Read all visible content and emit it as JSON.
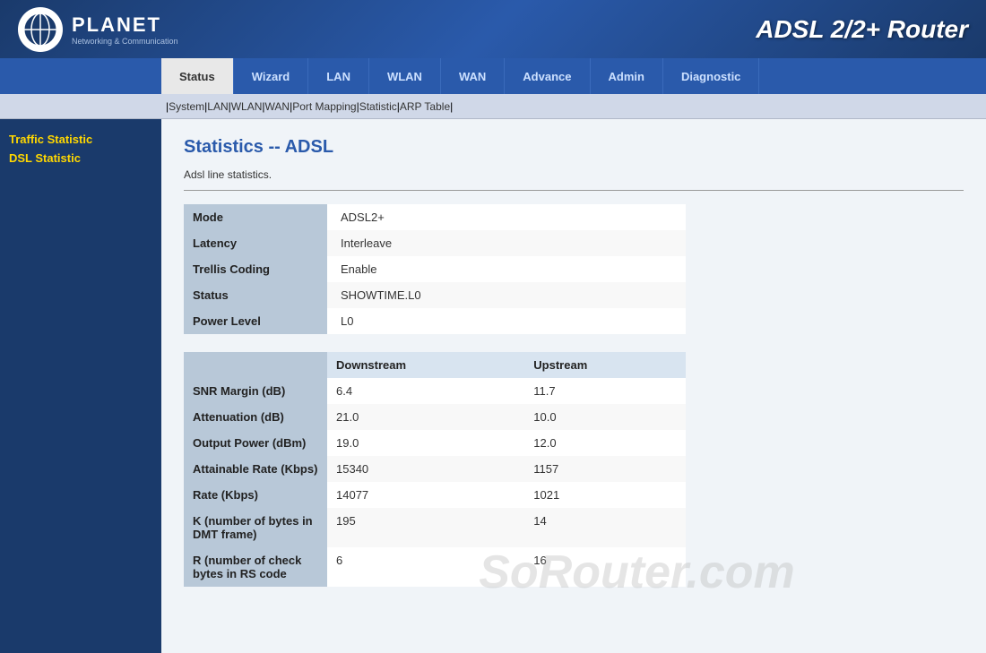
{
  "header": {
    "brand": "PLANET",
    "tagline": "Networking & Communication",
    "router_title": "ADSL 2/2+ Router"
  },
  "navbar": {
    "items": [
      {
        "id": "status",
        "label": "Status",
        "active": true
      },
      {
        "id": "wizard",
        "label": "Wizard",
        "active": false
      },
      {
        "id": "lan",
        "label": "LAN",
        "active": false
      },
      {
        "id": "wlan",
        "label": "WLAN",
        "active": false
      },
      {
        "id": "wan",
        "label": "WAN",
        "active": false
      },
      {
        "id": "advance",
        "label": "Advance",
        "active": false
      },
      {
        "id": "admin",
        "label": "Admin",
        "active": false
      },
      {
        "id": "diagnostic",
        "label": "Diagnostic",
        "active": false
      }
    ]
  },
  "subnav": {
    "links": [
      "System",
      "LAN",
      "WLAN",
      "WAN",
      "Port Mapping",
      "Statistic",
      "ARP Table"
    ]
  },
  "sidebar": {
    "items": [
      {
        "id": "traffic-statistic",
        "label": "Traffic Statistic"
      },
      {
        "id": "dsl-statistic",
        "label": "DSL Statistic"
      }
    ]
  },
  "main": {
    "page_title": "Statistics -- ADSL",
    "description": "Adsl line statistics.",
    "basic_stats": [
      {
        "label": "Mode",
        "value": "ADSL2+"
      },
      {
        "label": "Latency",
        "value": "Interleave"
      },
      {
        "label": "Trellis Coding",
        "value": "Enable"
      },
      {
        "label": "Status",
        "value": "SHOWTIME.L0"
      },
      {
        "label": "Power Level",
        "value": "L0"
      }
    ],
    "metrics": {
      "col_downstream": "Downstream",
      "col_upstream": "Upstream",
      "rows": [
        {
          "label": "SNR Margin (dB)",
          "downstream": "6.4",
          "upstream": "11.7"
        },
        {
          "label": "Attenuation (dB)",
          "downstream": "21.0",
          "upstream": "10.0"
        },
        {
          "label": "Output Power (dBm)",
          "downstream": "19.0",
          "upstream": "12.0"
        },
        {
          "label": "Attainable Rate (Kbps)",
          "downstream": "15340",
          "upstream": "1157"
        },
        {
          "label": "Rate (Kbps)",
          "downstream": "14077",
          "upstream": "1021"
        },
        {
          "label": "K (number of bytes in DMT frame)",
          "downstream": "195",
          "upstream": "14"
        },
        {
          "label": "R (number of check bytes in RS code",
          "downstream": "6",
          "upstream": "16"
        }
      ]
    },
    "watermark": "SoRouter.com"
  }
}
